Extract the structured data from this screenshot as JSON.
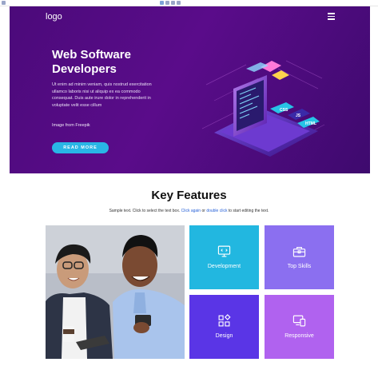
{
  "header": {
    "logo": "logo",
    "menu_icon": "hamburger-menu-icon"
  },
  "hero": {
    "title": "Web Software Developers",
    "description": "Ut enim ad minim veniam, quis nostrud exercitation ullamco laboris nisi ut aliquip ex ea commodo consequat. Duis aute irure dolor in reprehenderit in voluptate velit esse cillum",
    "credit": "Image from  Freepik",
    "button": "READ MORE",
    "illustration": "isometric-laptop-code-illustration",
    "illustration_labels": [
      "CSS",
      "JS",
      "HTML"
    ]
  },
  "features": {
    "title": "Key Features",
    "sub_parts": [
      "Sample text. Click to select the text box. ",
      "Click again",
      " or ",
      "double click",
      " to start editing the text."
    ],
    "photo": "two-smiling-colleagues-photo",
    "tiles": [
      {
        "label": "Development",
        "icon": "monitor-code-icon",
        "color": "#22b7e0"
      },
      {
        "label": "Top Skills",
        "icon": "toolbox-icon",
        "color": "#8b6ff0"
      },
      {
        "label": "Design",
        "icon": "shapes-icon",
        "color": "#5a35e6"
      },
      {
        "label": "Responsive",
        "icon": "devices-icon",
        "color": "#b062ef"
      }
    ]
  },
  "colors": {
    "hero_bg": "#4b0a7a",
    "accent": "#29b6e6"
  }
}
